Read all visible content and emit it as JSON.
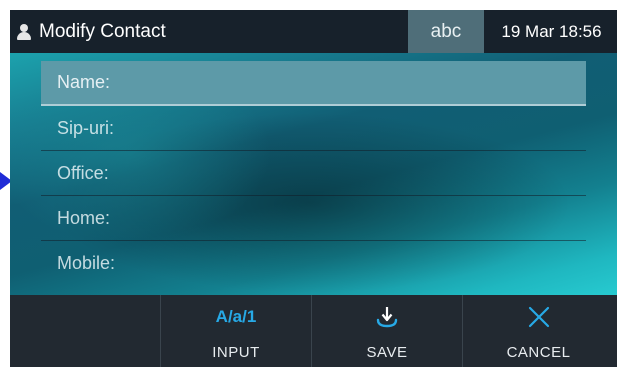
{
  "header": {
    "title": "Modify Contact",
    "mode": "abc",
    "datetime": "19 Mar 18:56"
  },
  "fields": [
    {
      "label": "Name:",
      "selected": true
    },
    {
      "label": "Sip-uri:",
      "selected": false
    },
    {
      "label": "Office:",
      "selected": false
    },
    {
      "label": "Home:",
      "selected": false
    },
    {
      "label": "Mobile:",
      "selected": false
    }
  ],
  "softkeys": {
    "input_label": "INPUT",
    "input_glyph": "A/a/1",
    "save_label": "SAVE",
    "cancel_label": "CANCEL"
  },
  "icons": {
    "header": "user-icon",
    "save": "save-down-arrow-icon",
    "cancel": "close-x-icon",
    "pointer": "pointer-arrow-icon"
  },
  "colors": {
    "header_bg": "#17212b",
    "mode_bg": "#4f6e79",
    "selected_row": "#5d9aa8",
    "softkey_bg": "#222931",
    "accent": "#27a9e6",
    "pointer": "#1f2bd6"
  }
}
